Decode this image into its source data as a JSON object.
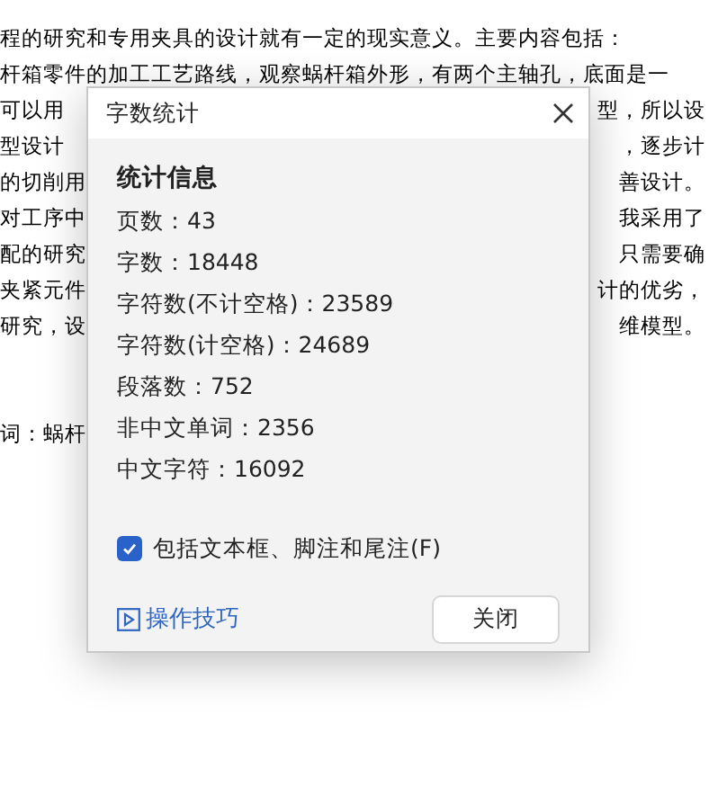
{
  "document": {
    "lines": [
      {
        "left": "程的研究和专用夹具的设计就有一定的现实意义。主要内容包括："
      },
      {
        "left": "杆箱零件的加工工艺路线，观察蜗杆箱外形，有两个主轴孔，底面是一"
      },
      {
        "left": "可以用",
        "right": "型，所以设"
      },
      {
        "left": "型设计",
        "right": "，逐步计"
      },
      {
        "left": "的切削用",
        "right": "善设计。"
      },
      {
        "left": "对工序中",
        "right": "我采用了"
      },
      {
        "left": "配的研究",
        "right": "只需要确"
      },
      {
        "left": "夹紧元件",
        "right": "计的优劣，"
      },
      {
        "left": "研究，设",
        "right": "维模型。"
      }
    ],
    "keywords": "词：蜗杆"
  },
  "dialog": {
    "title": "字数统计",
    "section_title": "统计信息",
    "stats": [
      "页数：43",
      "字数：18448",
      "字符数(不计空格)：23589",
      "字符数(计空格)：24689",
      "段落数：752",
      "非中文单词：2356",
      "中文字符：16092"
    ],
    "checkbox": {
      "label": "包括文本框、脚注和尾注(F)",
      "checked": true
    },
    "tips_link": "操作技巧",
    "close_button": "关闭"
  }
}
